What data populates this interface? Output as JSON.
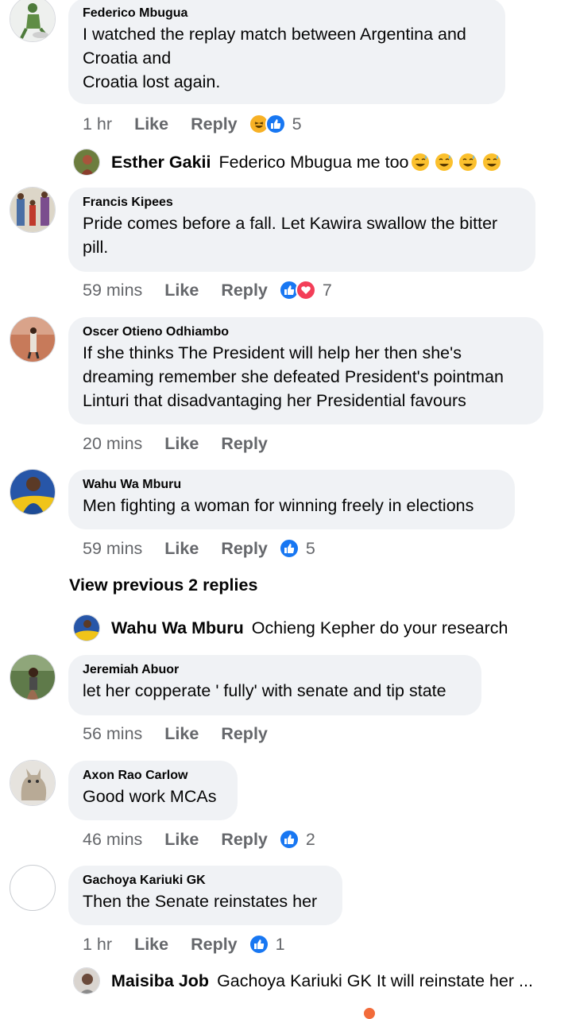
{
  "comments": [
    {
      "author": "Federico Mbugua",
      "lines": [
        "I watched the replay  match between Argentina and",
        "Croatia and",
        "Croatia lost again."
      ],
      "time": "1 hr",
      "like": "Like",
      "reply": "Reply",
      "reactions": [
        "haha",
        "like"
      ],
      "count": "5"
    },
    {
      "author": "Francis Kipees",
      "lines": [
        "Pride comes before a fall. Let Kawira swallow the bitter",
        "pill."
      ],
      "time": "59 mins",
      "like": "Like",
      "reply": "Reply",
      "reactions": [
        "like",
        "love"
      ],
      "count": "7"
    },
    {
      "author": "Oscer Otieno Odhiambo",
      "lines": [
        "If she thinks The President will help her then she's",
        "dreaming remember she defeated President's pointman",
        "Linturi that disadvantaging her Presidential favours"
      ],
      "time": "20 mins",
      "like": "Like",
      "reply": "Reply",
      "reactions": [],
      "count": ""
    },
    {
      "author": "Wahu Wa Mburu",
      "lines": [
        "Men fighting a woman for winning freely in elections"
      ],
      "time": "59 mins",
      "like": "Like",
      "reply": "Reply",
      "reactions": [
        "like"
      ],
      "count": "5"
    },
    {
      "author": "Jeremiah Abuor",
      "lines": [
        "let her copperate ' fully' with senate and tip state"
      ],
      "time": "56 mins",
      "like": "Like",
      "reply": "Reply",
      "reactions": [],
      "count": ""
    },
    {
      "author": "Axon Rao Carlow",
      "lines": [
        "Good work MCAs"
      ],
      "time": "46 mins",
      "like": "Like",
      "reply": "Reply",
      "reactions": [
        "like"
      ],
      "count": "2"
    },
    {
      "author": "Gachoya Kariuki GK",
      "lines": [
        "Then the Senate reinstates her"
      ],
      "time": "1 hr",
      "like": "Like",
      "reply": "Reply",
      "reactions": [
        "like"
      ],
      "count": "1"
    }
  ],
  "replies": [
    {
      "name": "Esther Gakii",
      "text": "Federico Mbugua  me too"
    },
    {
      "name": "Wahu Wa Mburu",
      "text": "Ochieng Kepher do your research"
    },
    {
      "name": "Maisiba Job",
      "text": "Gachoya Kariuki GK It will reinstate her ..."
    }
  ],
  "view_previous": "View previous 2 replies",
  "colors": {
    "bubble": "#f0f2f5",
    "like_blue": "#1877f2",
    "love_red": "#f33e58",
    "meta_gray": "#65676b"
  }
}
